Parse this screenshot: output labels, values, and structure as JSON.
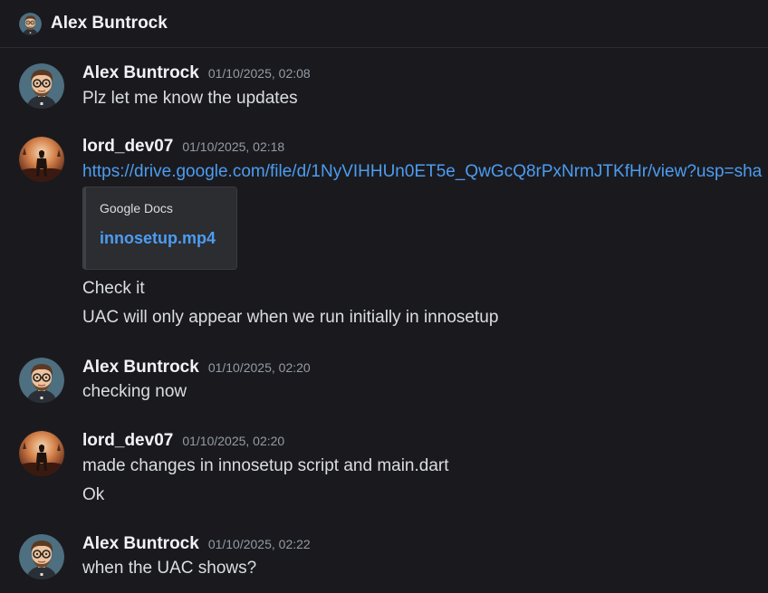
{
  "header": {
    "title": "Alex Buntrock",
    "avatar_icon": "alex-avatar-icon"
  },
  "colors": {
    "background": "#1a1a1e",
    "link": "#4d9cf0",
    "timestamp": "#949ba4",
    "embed_bg": "#2b2d31"
  },
  "messages": [
    {
      "author": "Alex Buntrock",
      "time": "01/10/2025, 02:08",
      "lines": [
        "Plz let me know the updates"
      ]
    },
    {
      "author": "lord_dev07",
      "time": "01/10/2025, 02:18",
      "link": "https://drive.google.com/file/d/1NyVIHHUn0ET5e_QwGcQ8rPxNrmJTKfHr/view?usp=sha",
      "embed": {
        "provider": "Google Docs",
        "title": "innosetup.mp4"
      },
      "lines": [
        "Check it",
        "UAC will only appear when we run initially in innosetup"
      ]
    },
    {
      "author": "Alex Buntrock",
      "time": "01/10/2025, 02:20",
      "lines": [
        "checking now"
      ]
    },
    {
      "author": "lord_dev07",
      "time": "01/10/2025, 02:20",
      "lines": [
        "made changes in innosetup script and main.dart",
        "Ok"
      ]
    },
    {
      "author": "Alex Buntrock",
      "time": "01/10/2025, 02:22",
      "lines": [
        "when the UAC shows?"
      ]
    }
  ]
}
